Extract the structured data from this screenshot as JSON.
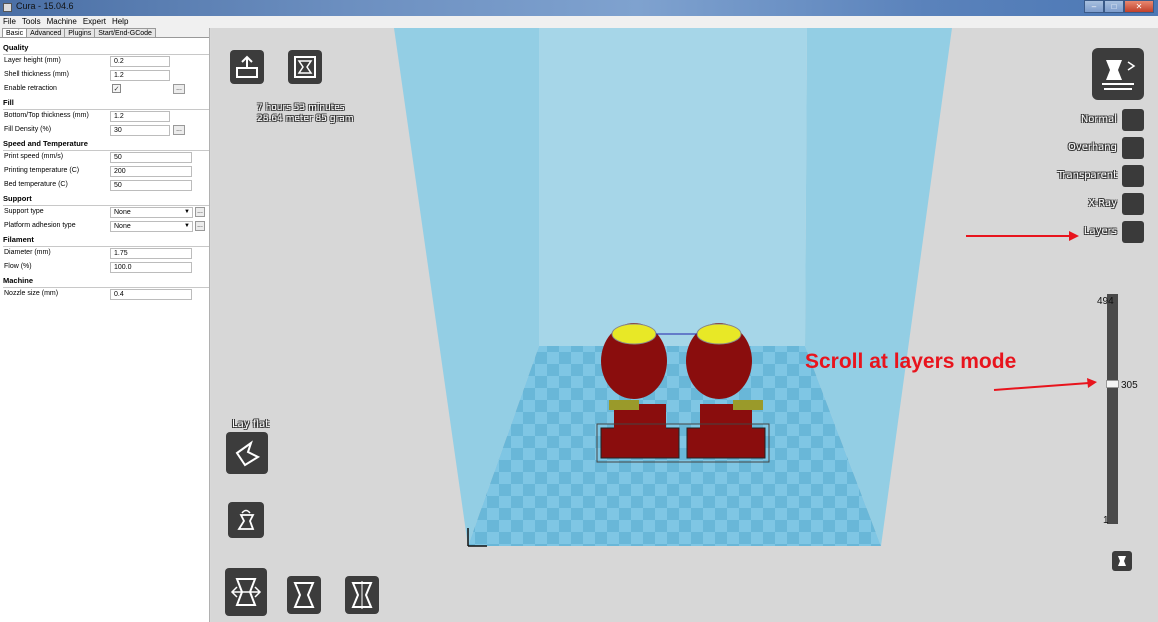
{
  "window": {
    "title": "Cura - 15.04.6"
  },
  "menu": [
    "File",
    "Tools",
    "Machine",
    "Expert",
    "Help"
  ],
  "tabs": [
    "Basic",
    "Advanced",
    "Plugins",
    "Start/End-GCode"
  ],
  "sections": {
    "quality": {
      "title": "Quality",
      "layer_height": {
        "label": "Layer height (mm)",
        "value": "0.2"
      },
      "shell_thickness": {
        "label": "Shell thickness (mm)",
        "value": "1.2"
      },
      "enable_retraction": {
        "label": "Enable retraction",
        "checked": "✓"
      }
    },
    "fill": {
      "title": "Fill",
      "bottom_top": {
        "label": "Bottom/Top thickness (mm)",
        "value": "1.2"
      },
      "fill_density": {
        "label": "Fill Density (%)",
        "value": "30"
      }
    },
    "speed": {
      "title": "Speed and Temperature",
      "print_speed": {
        "label": "Print speed (mm/s)",
        "value": "50"
      },
      "printing_temp": {
        "label": "Printing temperature (C)",
        "value": "200"
      },
      "bed_temp": {
        "label": "Bed temperature (C)",
        "value": "50"
      }
    },
    "support": {
      "title": "Support",
      "support_type": {
        "label": "Support type",
        "value": "None"
      },
      "platform_adhesion": {
        "label": "Platform adhesion type",
        "value": "None"
      }
    },
    "filament": {
      "title": "Filament",
      "diameter": {
        "label": "Diameter (mm)",
        "value": "1.75"
      },
      "flow": {
        "label": "Flow (%)",
        "value": "100.0"
      }
    },
    "machine": {
      "title": "Machine",
      "nozzle": {
        "label": "Nozzle size (mm)",
        "value": "0.4"
      }
    }
  },
  "viewport": {
    "print_time": "7 hours 53 minutes",
    "print_material": "28.64 meter 85 gram",
    "lay_flat": "Lay flat",
    "view_modes": [
      "Normal",
      "Overhang",
      "Transparent",
      "X-Ray",
      "Layers"
    ],
    "slider": {
      "max": "494",
      "current": "305",
      "min": "1",
      "level_fraction": 0.617
    },
    "annotation": "Scroll at layers mode"
  },
  "colors": {
    "annotation": "#e8141d",
    "model": "#8a0d0d",
    "top": "#e8e826",
    "volume": "#7fc6e4"
  }
}
